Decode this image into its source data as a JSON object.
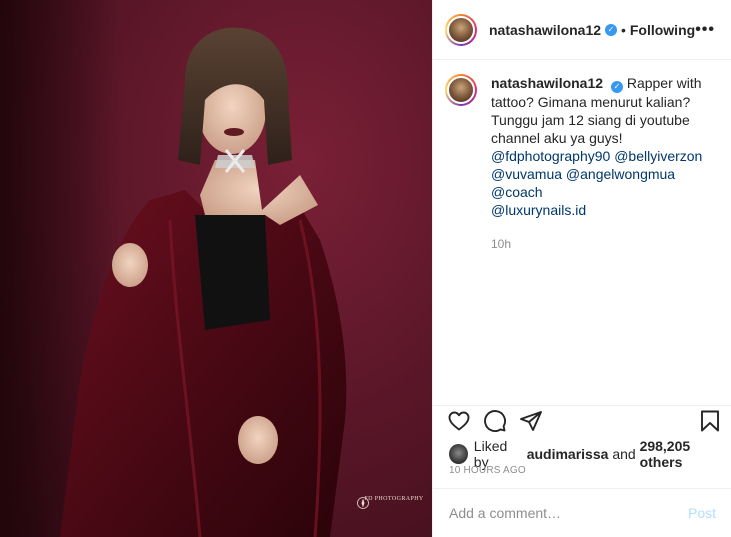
{
  "post": {
    "username": "natashawilona12",
    "follow_label": "Following",
    "separator": "•",
    "more_label": "•••",
    "verified_mark": "✓"
  },
  "caption": {
    "username": "natashawilona12",
    "text": "Rapper with tattoo? Gimana menurut kalian? Tunggu jam 12 siang di youtube channel aku ya guys!",
    "mentions": [
      "@fdphotography90",
      "@bellyiverzon",
      "@vuvamua",
      "@angelwongmua",
      "@coach",
      "@luxurynails.id"
    ],
    "time": "10h"
  },
  "likes": {
    "prefix": "Liked by",
    "user": "audimarissa",
    "joiner": "and",
    "others": "298,205 others"
  },
  "posted_ago": "10 HOURS AGO",
  "comment": {
    "placeholder": "Add a comment…",
    "post_label": "Post"
  },
  "photo": {
    "watermark": "FD PHOTOGRAPHY"
  },
  "icons": {
    "like": "heart-icon",
    "comment": "comment-icon",
    "share": "paper-plane-icon",
    "save": "bookmark-icon",
    "more": "more-options-icon",
    "verified": "verified-badge-icon"
  },
  "colors": {
    "background_wall": "#5c1729",
    "link": "#00376b",
    "muted": "#8e8e8e",
    "verified": "#3897f0",
    "post_disabled": "#b2dffc"
  }
}
